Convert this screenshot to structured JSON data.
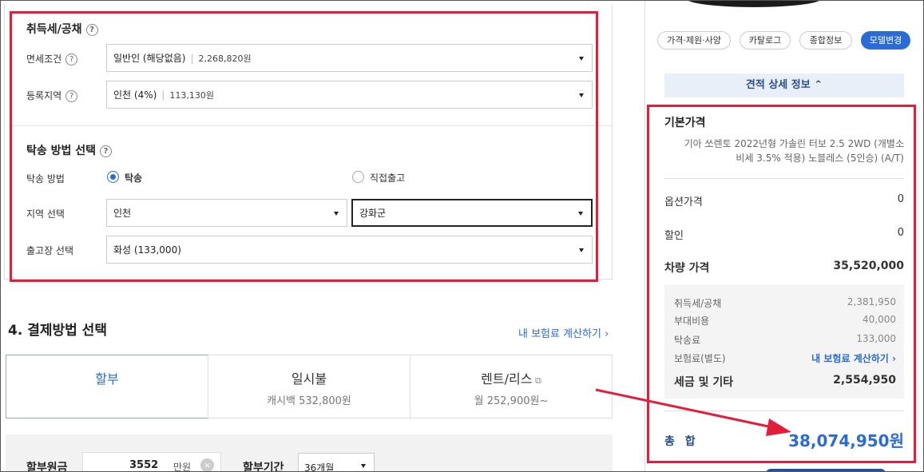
{
  "tax": {
    "title": "취득세/공채",
    "q": "?",
    "exemption_label": "면세조건",
    "exemption_value": "일반인 (해당없음)",
    "exemption_amount": "2,268,820원",
    "region_label": "등록지역",
    "region_value": "인천 (4%)",
    "region_amount": "113,130원"
  },
  "delivery": {
    "title": "탁송 방법 선택",
    "method_label": "탁송 방법",
    "option_delivery": "탁송",
    "option_pickup": "직접출고",
    "area_label": "지역 선택",
    "area_value": "인천",
    "district_value": "강화군",
    "depot_label": "출고장 선택",
    "depot_value": "화성 (133,000)"
  },
  "payment": {
    "title": "4. 결제방법 선택",
    "insurance_link": "내 보험료 계산하기",
    "tabs": [
      {
        "title": "할부",
        "sub": ""
      },
      {
        "title": "일시불",
        "sub": "캐시백 532,800원"
      },
      {
        "title": "렌트/리스",
        "sub": "월 252,900원~"
      }
    ],
    "principal_label": "할부원금",
    "principal_value": "3552",
    "principal_unit": "만원",
    "period_label": "할부기간",
    "period_value": "36개월"
  },
  "sidebar": {
    "pills": [
      "가격·제원·사양",
      "카탈로그",
      "종합정보",
      "모델변경"
    ],
    "detail_toggle": "견적 상세 정보",
    "base_price_title": "기본가격",
    "base_price_desc_1": "기아 쏘렌토 2022년형 가솔린 터보 2.5 2WD (개별소",
    "base_price_desc_2": "비세 3.5% 적용) 노블레스 (5인승) (A/T)",
    "option_label": "옵션가격",
    "option_value": "0",
    "discount_label": "할인",
    "discount_value": "0",
    "car_price_label": "차량 가격",
    "car_price_value": "35,520,000",
    "breakdown": [
      {
        "label": "취득세/공채",
        "value": "2,381,950"
      },
      {
        "label": "부대비용",
        "value": "40,000"
      },
      {
        "label": "탁송료",
        "value": "133,000"
      },
      {
        "label": "보험료(별도)",
        "value": "내 보험료 계산하기"
      }
    ],
    "tax_etc_label": "세금 및 기타",
    "tax_etc_value": "2,554,950",
    "total_label": "총 합",
    "total_value": "38,074,950원"
  },
  "colors": {
    "accent": "#2b6bd6",
    "annotation": "#e21e3c"
  }
}
